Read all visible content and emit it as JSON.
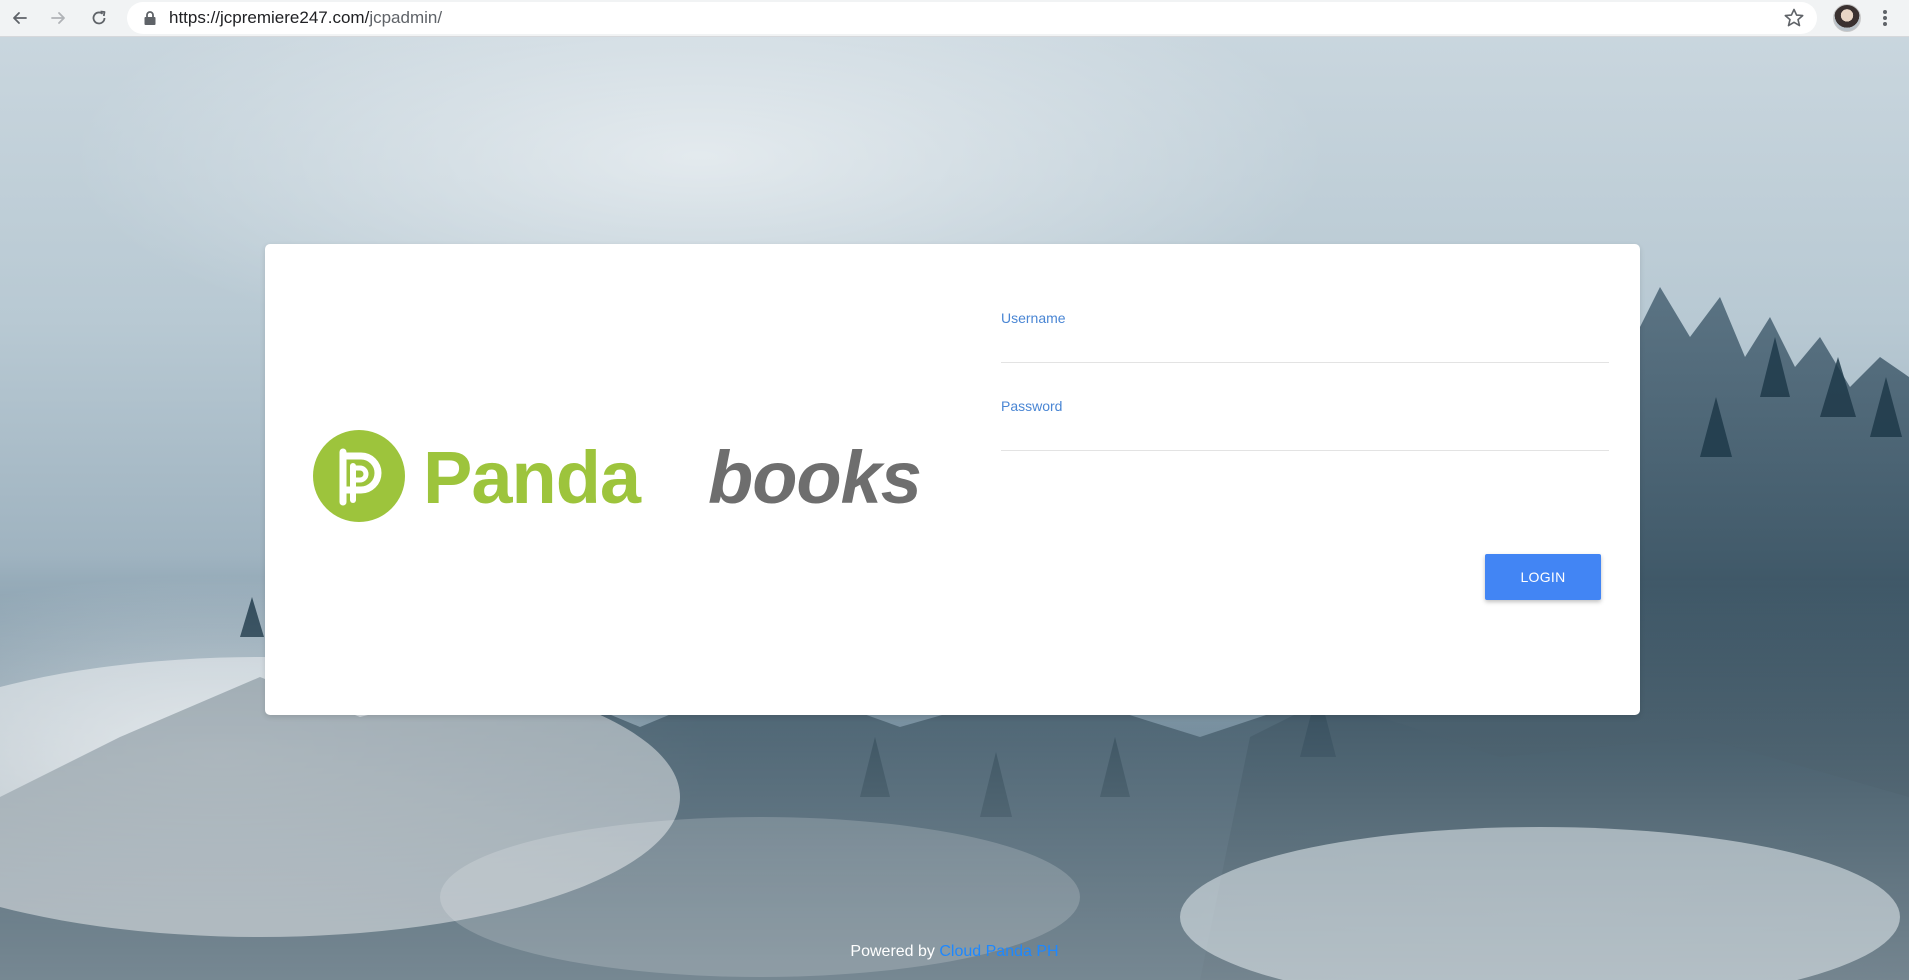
{
  "browser": {
    "url_host": "https://jcpremiere247.com/",
    "url_path": "jcpadmin/",
    "icons": [
      "back-arrow-icon",
      "forward-arrow-icon",
      "reload-icon",
      "lock-icon",
      "star-icon",
      "avatar",
      "kebab-menu-icon"
    ]
  },
  "logo": {
    "word_1": "Panda",
    "word_2": "books",
    "colors": {
      "green": "#9dc43c",
      "gray": "#6e6e6e"
    }
  },
  "login_form": {
    "username_label": "Username",
    "username_value": "",
    "password_label": "Password",
    "password_value": "",
    "login_button_label": "LOGIN"
  },
  "footer": {
    "powered_by": "Powered by",
    "link_text": "Cloud Panda PH"
  },
  "colors": {
    "accent": "#4285f4",
    "label_blue": "#4a86d4",
    "footer_link": "#1e88ff"
  }
}
